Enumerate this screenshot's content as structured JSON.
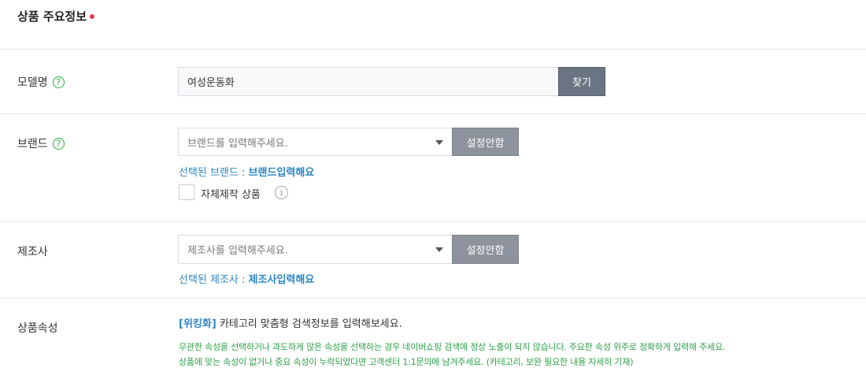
{
  "section": {
    "title": "상품 주요정보"
  },
  "model": {
    "label": "모델명",
    "help_icon": "question-circle-icon",
    "value": "여성운동화",
    "find_button": "찾기"
  },
  "brand": {
    "label": "브랜드",
    "help_icon": "question-circle-icon",
    "placeholder": "브랜드를 입력해주세요.",
    "unset_button": "설정안함",
    "selected_prefix": "선택된 브랜드 : ",
    "selected_value": "브랜드입력해요",
    "self_made_label": "자체제작 상품",
    "info_icon": "info-circle-icon",
    "self_made_checked": false
  },
  "manufacturer": {
    "label": "제조사",
    "placeholder": "제조사를 입력해주세요.",
    "unset_button": "설정안함",
    "selected_prefix": "선택된 제조사 : ",
    "selected_value": "제조사입력해요"
  },
  "attributes": {
    "label": "상품속성",
    "wiki_link": "[위킹화]",
    "wiki_text": " 카테고리 맞춤형 검색정보를 입력해보세요.",
    "notice_line1": "무관한 속성을 선택하거나 과도하게 많은 속성을 선택하는 경우 네이버쇼핑 검색에 정상 노출이 되지 않습니다. 주요한 속성 위주로 정확하게 입력해 주세요.",
    "notice_line2": "상품에 맞는 속성이 없거나 중요 속성이 누락되었다면 고객센터 1:1문의에 남겨주세요. (카테고리, 보완 필요한 내용 자세히 기재)"
  },
  "colors": {
    "required_dot": "#e8384f",
    "help_green": "#25b03d",
    "link_blue": "#2b86c5",
    "notice_green": "#2ca148"
  }
}
